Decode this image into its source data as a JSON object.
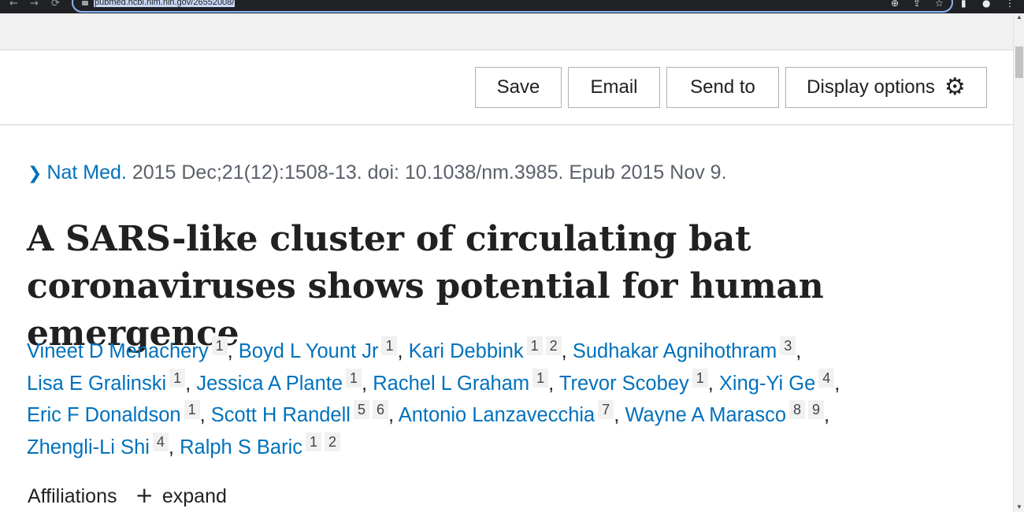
{
  "browser": {
    "url": "pubmed.ncbi.nlm.nih.gov/26552008/",
    "nav_icons": [
      "←",
      "→",
      "⟳"
    ],
    "right_icons": [
      "⊕",
      "⇪",
      "☆",
      "▮",
      "●",
      "⋮"
    ]
  },
  "toolbar": {
    "save_label": "Save",
    "email_label": "Email",
    "send_to_label": "Send to",
    "display_options_label": "Display options",
    "gear_glyph": "⚙"
  },
  "citation": {
    "chevron": "❯",
    "journal": "Nat Med.",
    "details": " 2015 Dec;21(12):1508-13. doi: 10.1038/nm.3985. Epub 2015 Nov 9."
  },
  "article": {
    "title": "A SARS-like cluster of circulating bat coronaviruses shows potential for human emergence"
  },
  "authors": [
    {
      "name": "Vineet D Menachery",
      "refs": [
        "1"
      ]
    },
    {
      "name": "Boyd L Yount Jr",
      "refs": [
        "1"
      ]
    },
    {
      "name": "Kari Debbink",
      "refs": [
        "1",
        "2"
      ]
    },
    {
      "name": "Sudhakar Agnihothram",
      "refs": [
        "3"
      ]
    },
    {
      "name": "Lisa E Gralinski",
      "refs": [
        "1"
      ]
    },
    {
      "name": "Jessica A Plante",
      "refs": [
        "1"
      ]
    },
    {
      "name": "Rachel L Graham",
      "refs": [
        "1"
      ]
    },
    {
      "name": "Trevor Scobey",
      "refs": [
        "1"
      ]
    },
    {
      "name": "Xing-Yi Ge",
      "refs": [
        "4"
      ]
    },
    {
      "name": "Eric F Donaldson",
      "refs": [
        "1"
      ]
    },
    {
      "name": "Scott H Randell",
      "refs": [
        "5",
        "6"
      ]
    },
    {
      "name": "Antonio Lanzavecchia",
      "refs": [
        "7"
      ]
    },
    {
      "name": "Wayne A Marasco",
      "refs": [
        "8",
        "9"
      ]
    },
    {
      "name": "Zhengli-Li Shi",
      "refs": [
        "4"
      ]
    },
    {
      "name": "Ralph S Baric",
      "refs": [
        "1",
        "2"
      ]
    }
  ],
  "affiliations": {
    "label": "Affiliations",
    "expand_icon": "+",
    "expand_label": "expand"
  }
}
